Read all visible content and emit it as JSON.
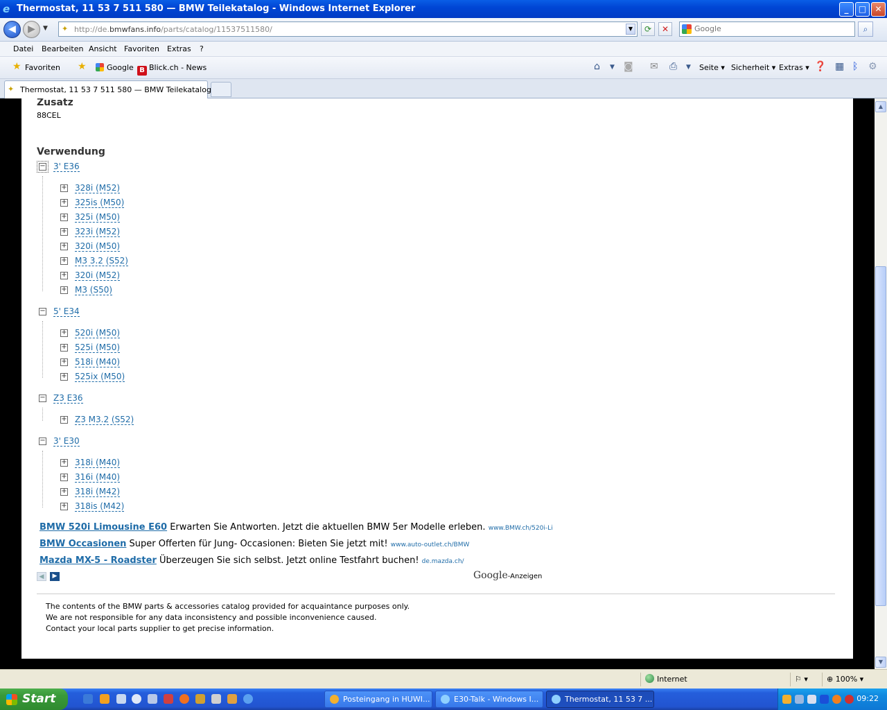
{
  "window": {
    "title": "Thermostat, 11 53 7 511 580 — BMW Teilekatalog - Windows Internet Explorer",
    "min_glyph": "_",
    "max_glyph": "□",
    "close_glyph": "✕"
  },
  "address": {
    "url_prefix": "http://de.",
    "url_domain": "bmwfans.info",
    "url_path": "/parts/catalog/11537511580/"
  },
  "search": {
    "placeholder": "Google"
  },
  "menu": [
    "Datei",
    "Bearbeiten",
    "Ansicht",
    "Favoriten",
    "Extras",
    "?"
  ],
  "favorites": {
    "label": "Favoriten",
    "links": [
      "Google",
      "Blick.ch - News"
    ],
    "commands": [
      "Seite",
      "Sicherheit",
      "Extras"
    ]
  },
  "tab": {
    "label": "Thermostat, 11 53 7 511 580 — BMW Teilekatalog"
  },
  "content": {
    "zusatz_heading": "Zusatz",
    "zusatz_value": "88CEL",
    "verwendung_heading": "Verwendung",
    "tree": [
      {
        "model": "3' E36",
        "variants": [
          "328i (M52)",
          "325is (M50)",
          "325i (M50)",
          "323i (M52)",
          "320i (M50)",
          "M3 3.2 (S52)",
          "320i (M52)",
          "M3 (S50)"
        ]
      },
      {
        "model": "5' E34",
        "variants": [
          "520i (M50)",
          "525i (M50)",
          "518i (M40)",
          "525ix (M50)"
        ]
      },
      {
        "model": "Z3 E36",
        "variants": [
          "Z3 M3.2 (S52)"
        ]
      },
      {
        "model": "3' E30",
        "variants": [
          "318i (M40)",
          "316i (M40)",
          "318i (M42)",
          "318is (M42)"
        ]
      }
    ],
    "ads": [
      {
        "title": "BMW 520i Limousine E60",
        "text": "Erwarten Sie Antworten. Jetzt die aktuellen BMW 5er Modelle erleben.",
        "url": "www.BMW.ch/520i-Li"
      },
      {
        "title": "BMW Occasionen",
        "text": "Super Offerten für Jung- Occasionen: Bieten Sie jetzt mit!",
        "url": "www.auto-outlet.ch/BMW"
      },
      {
        "title": "Mazda MX-5 - Roadster",
        "text": "Überzeugen Sie sich selbst. Jetzt online Testfahrt buchen!",
        "url": "de.mazda.ch/"
      }
    ],
    "google_ads": {
      "brand": "Google",
      "suffix": "-Anzeigen"
    },
    "disclaimer": [
      "The contents of the BMW parts & accessories catalog provided for acquaintance purposes only.",
      "We are not responsible for any data inconsistency and possible inconvenience caused.",
      "Contact your local parts supplier to get precise information."
    ]
  },
  "status": {
    "zone": "Internet",
    "zoom": "100%"
  },
  "taskbar": {
    "start": "Start",
    "tasks": [
      "Posteingang in HUWI...",
      "E30-Talk - Windows I...",
      "Thermostat, 11 53 7 ..."
    ],
    "clock": "09:22"
  }
}
